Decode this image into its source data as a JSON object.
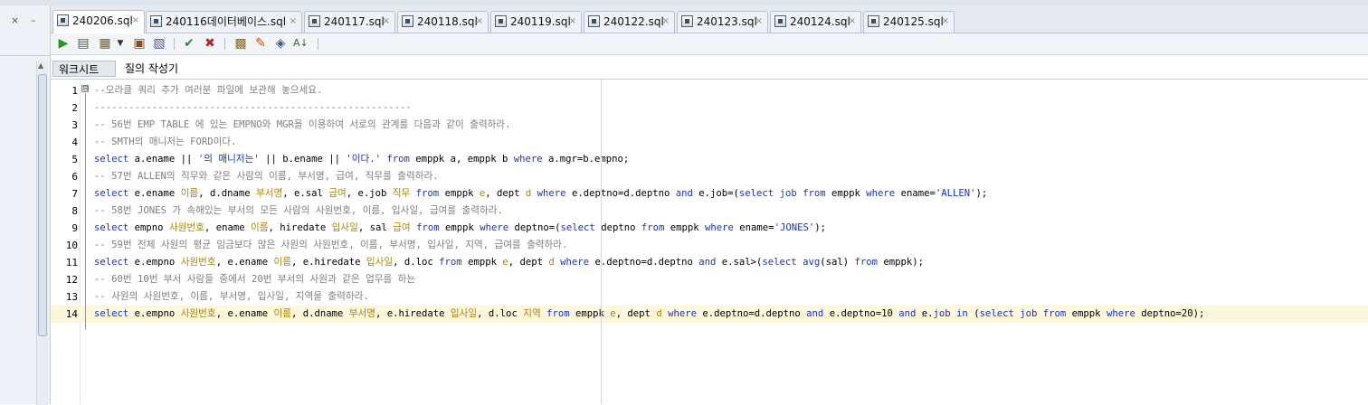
{
  "window": {
    "dock_close": "×",
    "dock_min": "–"
  },
  "tabs": [
    {
      "label": "240206.sql",
      "active": true
    },
    {
      "label": "240116데이터베이스.sql",
      "active": false
    },
    {
      "label": "240117.sql",
      "active": false
    },
    {
      "label": "240118.sql",
      "active": false
    },
    {
      "label": "240119.sql",
      "active": false
    },
    {
      "label": "240122.sql",
      "active": false
    },
    {
      "label": "240123.sql",
      "active": false
    },
    {
      "label": "240124.sql",
      "active": false
    },
    {
      "label": "240125.sql",
      "active": false
    }
  ],
  "tab_close": "×",
  "toolbar": {
    "icons": [
      "run-statement-icon",
      "run-script-icon",
      "autotrace-icon",
      "dropdown-icon",
      "explain-plan-icon",
      "sql-tuning-icon",
      "commit-icon",
      "rollback-icon",
      "sql-history-icon",
      "eraser-icon",
      "connection-icon",
      "format-icon"
    ]
  },
  "subtabs": [
    {
      "label": "워크시트",
      "active": true
    },
    {
      "label": "질의 작성기",
      "active": false
    }
  ],
  "editor": {
    "fold_marker": "⊟",
    "current_line": 14,
    "lines": [
      {
        "n": "1",
        "tokens": [
          {
            "t": "--오라클 쿼리 추가 여러분 파일에 보관해 놓으세요.",
            "c": "cm"
          }
        ]
      },
      {
        "n": "2",
        "tokens": [
          {
            "t": "-------------------------------------------------------",
            "c": "cm"
          }
        ]
      },
      {
        "n": "3",
        "tokens": [
          {
            "t": "-- 56번 EMP TABLE 에 있는 EMPNO와 MGR을 이용하여 서로의 관계를 다음과 같이 출력하라.",
            "c": "cm"
          }
        ]
      },
      {
        "n": "4",
        "tokens": [
          {
            "t": "-- SMTH의 매니저는 FORD이다.",
            "c": "cm"
          }
        ]
      },
      {
        "n": "5",
        "tokens": [
          {
            "t": "select",
            "c": "kw"
          },
          {
            "t": " a.ename || ",
            "c": ""
          },
          {
            "t": "'의 매니저는'",
            "c": "str"
          },
          {
            "t": " || b.ename || ",
            "c": ""
          },
          {
            "t": "'이다.'",
            "c": "str"
          },
          {
            "t": " ",
            "c": ""
          },
          {
            "t": "from",
            "c": "kw"
          },
          {
            "t": " emppk a, emppk b ",
            "c": ""
          },
          {
            "t": "where",
            "c": "kw"
          },
          {
            "t": " a.mgr=b.empno;",
            "c": ""
          }
        ]
      },
      {
        "n": "6",
        "tokens": [
          {
            "t": "-- 57번 ALLEN의 직무와 같은 사람의 이름, 부서명, 급여, 직무를 출력하라.",
            "c": "cm"
          }
        ]
      },
      {
        "n": "7",
        "tokens": [
          {
            "t": "select",
            "c": "kw"
          },
          {
            "t": " e.ename ",
            "c": ""
          },
          {
            "t": "이름",
            "c": "al"
          },
          {
            "t": ", d.dname ",
            "c": ""
          },
          {
            "t": "부서명",
            "c": "al"
          },
          {
            "t": ", e.sal ",
            "c": ""
          },
          {
            "t": "급여",
            "c": "al"
          },
          {
            "t": ", e.job ",
            "c": ""
          },
          {
            "t": "직무",
            "c": "al"
          },
          {
            "t": " ",
            "c": ""
          },
          {
            "t": "from",
            "c": "kw"
          },
          {
            "t": " emppk ",
            "c": ""
          },
          {
            "t": "e",
            "c": "al"
          },
          {
            "t": ", dept ",
            "c": ""
          },
          {
            "t": "d",
            "c": "al"
          },
          {
            "t": " ",
            "c": ""
          },
          {
            "t": "where",
            "c": "kw"
          },
          {
            "t": " e.deptno=d.deptno ",
            "c": ""
          },
          {
            "t": "and",
            "c": "kw"
          },
          {
            "t": " e.job=(",
            "c": ""
          },
          {
            "t": "select",
            "c": "kw"
          },
          {
            "t": " ",
            "c": ""
          },
          {
            "t": "job",
            "c": "kw"
          },
          {
            "t": " ",
            "c": ""
          },
          {
            "t": "from",
            "c": "kw"
          },
          {
            "t": " emppk ",
            "c": ""
          },
          {
            "t": "where",
            "c": "kw"
          },
          {
            "t": " ename=",
            "c": ""
          },
          {
            "t": "'ALLEN'",
            "c": "str"
          },
          {
            "t": ");",
            "c": ""
          }
        ]
      },
      {
        "n": "8",
        "tokens": [
          {
            "t": "-- 58번 JONES 가 속해있는 부서의 모든 사람의 사원번호, 이름, 입사일, 급여를 출력하라.",
            "c": "cm"
          }
        ]
      },
      {
        "n": "9",
        "tokens": [
          {
            "t": "select",
            "c": "kw"
          },
          {
            "t": " empno ",
            "c": ""
          },
          {
            "t": "사원번호",
            "c": "al"
          },
          {
            "t": ", ename ",
            "c": ""
          },
          {
            "t": "이름",
            "c": "al"
          },
          {
            "t": ", hiredate ",
            "c": ""
          },
          {
            "t": "입사일",
            "c": "al"
          },
          {
            "t": ", sal ",
            "c": ""
          },
          {
            "t": "급여",
            "c": "al"
          },
          {
            "t": " ",
            "c": ""
          },
          {
            "t": "from",
            "c": "kw"
          },
          {
            "t": " emppk ",
            "c": ""
          },
          {
            "t": "where",
            "c": "kw"
          },
          {
            "t": " deptno=(",
            "c": ""
          },
          {
            "t": "select",
            "c": "kw"
          },
          {
            "t": " deptno ",
            "c": ""
          },
          {
            "t": "from",
            "c": "kw"
          },
          {
            "t": " emppk ",
            "c": ""
          },
          {
            "t": "where",
            "c": "kw"
          },
          {
            "t": " ename=",
            "c": ""
          },
          {
            "t": "'JONES'",
            "c": "str"
          },
          {
            "t": ");",
            "c": ""
          }
        ]
      },
      {
        "n": "10",
        "tokens": [
          {
            "t": "-- 59번 전체 사원의 평균 임금보다 많은 사원의 사원번호, 이름, 부서명, 입사일, 지역, 급여를 출력하라.",
            "c": "cm"
          }
        ]
      },
      {
        "n": "11",
        "tokens": [
          {
            "t": "select",
            "c": "kw"
          },
          {
            "t": " e.empno ",
            "c": ""
          },
          {
            "t": "사원번호",
            "c": "al"
          },
          {
            "t": ", e.ename ",
            "c": ""
          },
          {
            "t": "이름",
            "c": "al"
          },
          {
            "t": ", e.hiredate ",
            "c": ""
          },
          {
            "t": "입사일",
            "c": "al"
          },
          {
            "t": ", d.loc ",
            "c": ""
          },
          {
            "t": "from",
            "c": "kw"
          },
          {
            "t": " emppk ",
            "c": ""
          },
          {
            "t": "e",
            "c": "al"
          },
          {
            "t": ", dept ",
            "c": ""
          },
          {
            "t": "d",
            "c": "al"
          },
          {
            "t": " ",
            "c": ""
          },
          {
            "t": "where",
            "c": "kw"
          },
          {
            "t": " e.deptno=d.deptno ",
            "c": ""
          },
          {
            "t": "and",
            "c": "kw"
          },
          {
            "t": " e.sal>(",
            "c": ""
          },
          {
            "t": "select",
            "c": "kw"
          },
          {
            "t": " ",
            "c": ""
          },
          {
            "t": "avg",
            "c": "kw"
          },
          {
            "t": "(sal) ",
            "c": ""
          },
          {
            "t": "from",
            "c": "kw"
          },
          {
            "t": " emppk);",
            "c": ""
          }
        ]
      },
      {
        "n": "12",
        "tokens": [
          {
            "t": "-- 60번 10번 부서 사람들 중에서 20번 부서의 사원과 같은 업무를 하는",
            "c": "cm"
          }
        ]
      },
      {
        "n": "13",
        "tokens": [
          {
            "t": "-- 사원의 사원번호, 이름, 부서명, 입사일, 지역을 출력하라.",
            "c": "cm"
          }
        ]
      },
      {
        "n": "14",
        "tokens": [
          {
            "t": "select",
            "c": "kw"
          },
          {
            "t": " e.empno ",
            "c": ""
          },
          {
            "t": "사원번호",
            "c": "al"
          },
          {
            "t": ", e.ename ",
            "c": ""
          },
          {
            "t": "이름",
            "c": "al"
          },
          {
            "t": ", d.dname ",
            "c": ""
          },
          {
            "t": "부서명",
            "c": "al"
          },
          {
            "t": ", e.hiredate ",
            "c": ""
          },
          {
            "t": "입사일",
            "c": "al"
          },
          {
            "t": ", d.loc ",
            "c": ""
          },
          {
            "t": "지역",
            "c": "al"
          },
          {
            "t": " ",
            "c": ""
          },
          {
            "t": "from",
            "c": "kw"
          },
          {
            "t": " emppk ",
            "c": ""
          },
          {
            "t": "e",
            "c": "al"
          },
          {
            "t": ", dept ",
            "c": ""
          },
          {
            "t": "d",
            "c": "al"
          },
          {
            "t": " ",
            "c": ""
          },
          {
            "t": "where",
            "c": "kw"
          },
          {
            "t": " e.deptno=d.deptno ",
            "c": ""
          },
          {
            "t": "and",
            "c": "kw"
          },
          {
            "t": " e.deptno=10 ",
            "c": ""
          },
          {
            "t": "and",
            "c": "kw"
          },
          {
            "t": " e.",
            "c": ""
          },
          {
            "t": "job",
            "c": "kw"
          },
          {
            "t": " ",
            "c": ""
          },
          {
            "t": "in",
            "c": "kw"
          },
          {
            "t": " (",
            "c": ""
          },
          {
            "t": "select",
            "c": "kw"
          },
          {
            "t": " ",
            "c": ""
          },
          {
            "t": "job",
            "c": "kw"
          },
          {
            "t": " ",
            "c": ""
          },
          {
            "t": "from",
            "c": "kw"
          },
          {
            "t": " emppk ",
            "c": ""
          },
          {
            "t": "where",
            "c": "kw"
          },
          {
            "t": " deptno=20);",
            "c": ""
          }
        ]
      }
    ]
  }
}
